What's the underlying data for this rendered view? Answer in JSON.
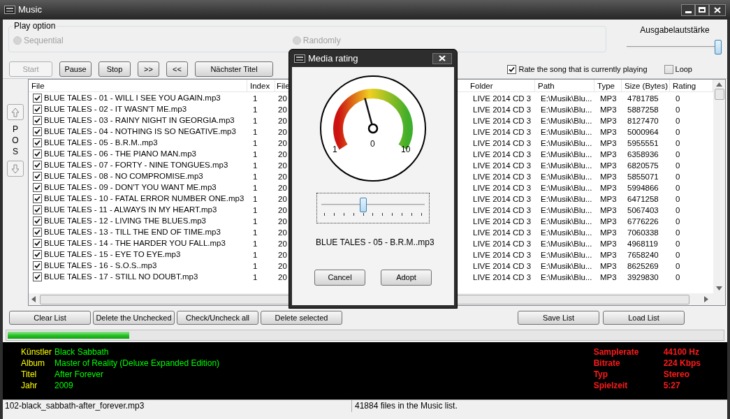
{
  "window": {
    "title": "Music"
  },
  "play_option": {
    "label": "Play option",
    "options": [
      {
        "label": "Sequential",
        "selected": false,
        "disabled": true
      },
      {
        "label": "Randomly",
        "selected": false,
        "disabled": true
      }
    ]
  },
  "volume": {
    "label": "Ausgabelautstärke",
    "level": 1.0
  },
  "controls": [
    {
      "label": "Start",
      "disabled": true
    },
    {
      "label": "Pause",
      "disabled": false
    },
    {
      "label": "Stop",
      "disabled": false
    },
    {
      "label": ">>",
      "disabled": false
    },
    {
      "label": "<<",
      "disabled": false
    },
    {
      "label": "Nächster Titel",
      "disabled": false
    }
  ],
  "rate_current": {
    "label": "Rate the song that is currently playing",
    "checked": true
  },
  "loop": {
    "label": "Loop",
    "checked": false
  },
  "position_panel": {
    "letters": [
      "P",
      "O",
      "S"
    ]
  },
  "table": {
    "columns": [
      "File",
      "Index",
      "File",
      "Folder",
      "Path",
      "Type",
      "Size (Bytes)",
      "Rating"
    ],
    "rows": [
      {
        "checked": true,
        "cells": [
          "BLUE TALES - 01 - WILL I SEE YOU AGAIN.mp3",
          "1",
          "20",
          "LIVE 2014 CD 3",
          "E:\\Musik\\Blu...",
          "MP3",
          "4781785",
          "0"
        ]
      },
      {
        "checked": true,
        "cells": [
          "BLUE TALES - 02 - IT WASN'T ME.mp3",
          "1",
          "20",
          "LIVE 2014 CD 3",
          "E:\\Musik\\Blu...",
          "MP3",
          "5887258",
          "0"
        ]
      },
      {
        "checked": true,
        "cells": [
          "BLUE TALES - 03 - RAINY NIGHT IN GEORGIA.mp3",
          "1",
          "20",
          "LIVE 2014 CD 3",
          "E:\\Musik\\Blu...",
          "MP3",
          "8127470",
          "0"
        ]
      },
      {
        "checked": true,
        "cells": [
          "BLUE TALES - 04 - NOTHING IS SO NEGATIVE.mp3",
          "1",
          "20",
          "LIVE 2014 CD 3",
          "E:\\Musik\\Blu...",
          "MP3",
          "5000964",
          "0"
        ]
      },
      {
        "checked": true,
        "cells": [
          "BLUE TALES - 05 - B.R.M..mp3",
          "1",
          "20",
          "LIVE 2014 CD 3",
          "E:\\Musik\\Blu...",
          "MP3",
          "5955551",
          "0"
        ]
      },
      {
        "checked": true,
        "cells": [
          "BLUE TALES - 06 - THE PIANO MAN.mp3",
          "1",
          "20",
          "LIVE 2014 CD 3",
          "E:\\Musik\\Blu...",
          "MP3",
          "6358936",
          "0"
        ]
      },
      {
        "checked": true,
        "cells": [
          "BLUE TALES - 07 - FORTY - NINE TONGUES.mp3",
          "1",
          "20",
          "LIVE 2014 CD 3",
          "E:\\Musik\\Blu...",
          "MP3",
          "6820575",
          "0"
        ]
      },
      {
        "checked": true,
        "cells": [
          "BLUE TALES - 08 - NO COMPROMISE.mp3",
          "1",
          "20",
          "LIVE 2014 CD 3",
          "E:\\Musik\\Blu...",
          "MP3",
          "5855071",
          "0"
        ]
      },
      {
        "checked": true,
        "cells": [
          "BLUE TALES - 09 - DON'T YOU WANT ME.mp3",
          "1",
          "20",
          "LIVE 2014 CD 3",
          "E:\\Musik\\Blu...",
          "MP3",
          "5994866",
          "0"
        ]
      },
      {
        "checked": true,
        "cells": [
          "BLUE TALES - 10 - FATAL ERROR NUMBER ONE.mp3",
          "1",
          "20",
          "LIVE 2014 CD 3",
          "E:\\Musik\\Blu...",
          "MP3",
          "6471258",
          "0"
        ]
      },
      {
        "checked": true,
        "cells": [
          "BLUE TALES - 11 - ALWAYS IN MY HEART.mp3",
          "1",
          "20",
          "LIVE 2014 CD 3",
          "E:\\Musik\\Blu...",
          "MP3",
          "5067403",
          "0"
        ]
      },
      {
        "checked": true,
        "cells": [
          "BLUE TALES - 12 - LIVING THE BLUES.mp3",
          "1",
          "20",
          "LIVE 2014 CD 3",
          "E:\\Musik\\Blu...",
          "MP3",
          "6776226",
          "0"
        ]
      },
      {
        "checked": true,
        "cells": [
          "BLUE TALES - 13 - TILL THE END OF TIME.mp3",
          "1",
          "20",
          "LIVE 2014 CD 3",
          "E:\\Musik\\Blu...",
          "MP3",
          "7060338",
          "0"
        ]
      },
      {
        "checked": true,
        "cells": [
          "BLUE TALES - 14 - THE HARDER YOU FALL.mp3",
          "1",
          "20",
          "LIVE 2014 CD 3",
          "E:\\Musik\\Blu...",
          "MP3",
          "4968119",
          "0"
        ]
      },
      {
        "checked": true,
        "cells": [
          "BLUE TALES - 15 - EYE TO EYE.mp3",
          "1",
          "20",
          "LIVE 2014 CD 3",
          "E:\\Musik\\Blu...",
          "MP3",
          "7658240",
          "0"
        ]
      },
      {
        "checked": true,
        "cells": [
          "BLUE TALES - 16 - S.O.S..mp3",
          "1",
          "20",
          "LIVE 2014 CD 3",
          "E:\\Musik\\Blu...",
          "MP3",
          "8625269",
          "0"
        ]
      },
      {
        "checked": true,
        "cells": [
          "BLUE TALES - 17 - STILL NO DOUBT.mp3",
          "1",
          "20",
          "LIVE 2014 CD 3",
          "E:\\Musik\\Blu...",
          "MP3",
          "3929830",
          "0"
        ]
      }
    ]
  },
  "list_buttons_left": [
    "Clear List",
    "Delete the Unchecked",
    "Check/Uncheck all",
    "Delete selected"
  ],
  "list_buttons_right": [
    "Save List",
    "Load List"
  ],
  "progress": {
    "level": 0.17
  },
  "track_info": [
    {
      "label": "Künstler",
      "value": "Black Sabbath"
    },
    {
      "label": "Album",
      "value": "Master of Reality (Deluxe Expanded Edition)"
    },
    {
      "label": "Titel",
      "value": "After Forever"
    },
    {
      "label": "Jahr",
      "value": "2009"
    }
  ],
  "tech_info": [
    {
      "label": "Samplerate",
      "value": "44100 Hz"
    },
    {
      "label": "Bitrate",
      "value": "224 Kbps"
    },
    {
      "label": "Typ",
      "value": "Stereo"
    },
    {
      "label": "Spielzeit",
      "value": "5:27"
    }
  ],
  "status_bar": [
    "102-black_sabbath-after_forever.mp3",
    "41884 files in the Music list."
  ],
  "dialog": {
    "title": "Media rating",
    "gauge_labels": [
      "1",
      "0",
      "10"
    ],
    "level": 0.4,
    "file": "BLUE TALES - 05 - B.R.M..mp3",
    "buttons": [
      "Cancel",
      "Adopt"
    ]
  }
}
